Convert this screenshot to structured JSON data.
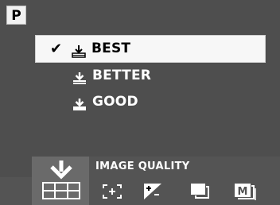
{
  "mode": {
    "letter": "P"
  },
  "menu": {
    "title": "IMAGE QUALITY",
    "items": [
      {
        "label": "BEST",
        "selected": true,
        "check": "✔"
      },
      {
        "label": "BETTER",
        "selected": false
      },
      {
        "label": "GOOD",
        "selected": false
      }
    ]
  },
  "icons": [
    "image-quality-icon",
    "focus-area-icon",
    "exposure-compensation-icon",
    "drive-mode-icon",
    "memory-icon"
  ]
}
